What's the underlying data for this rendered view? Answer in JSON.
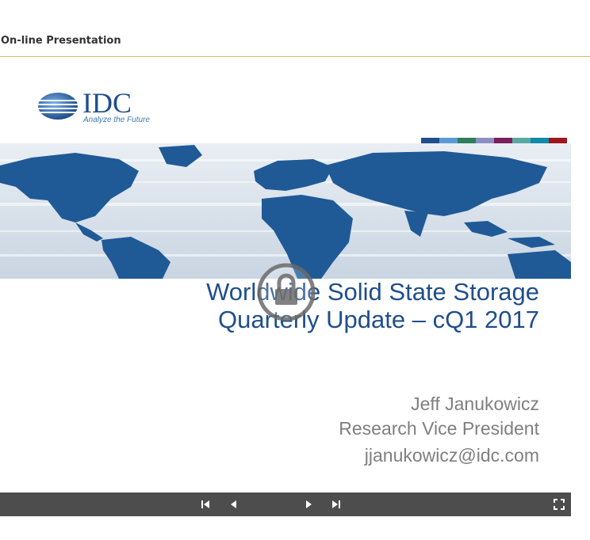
{
  "header": {
    "title": "On-line Presentation"
  },
  "slide": {
    "logo": {
      "wordmark": "IDC",
      "tagline": "Analyze the Future"
    },
    "accent_colors": [
      "#1f4e8c",
      "#5b9bd5",
      "#2e7d5b",
      "#8b8fc4",
      "#7a1f5c",
      "#5aa8a0",
      "#0f8aa8",
      "#a0141e"
    ],
    "title_line1": "Worldwide Solid State Storage",
    "title_line2": "Quarterly Update – cQ1 2017",
    "author_name": "Jeff Janukowicz",
    "author_role": "Research Vice President",
    "author_email": "jjanukowicz@idc.com"
  },
  "overlay": {
    "icon": "lock-icon"
  },
  "controls": {
    "first": "skip-first-icon",
    "prev": "previous-icon",
    "next": "next-icon",
    "last": "skip-last-icon",
    "fullscreen": "fullscreen-icon"
  },
  "colors": {
    "brand_blue": "#1f4e8c",
    "control_bar": "#4d4d4d",
    "header_rule": "#d9b36a"
  }
}
